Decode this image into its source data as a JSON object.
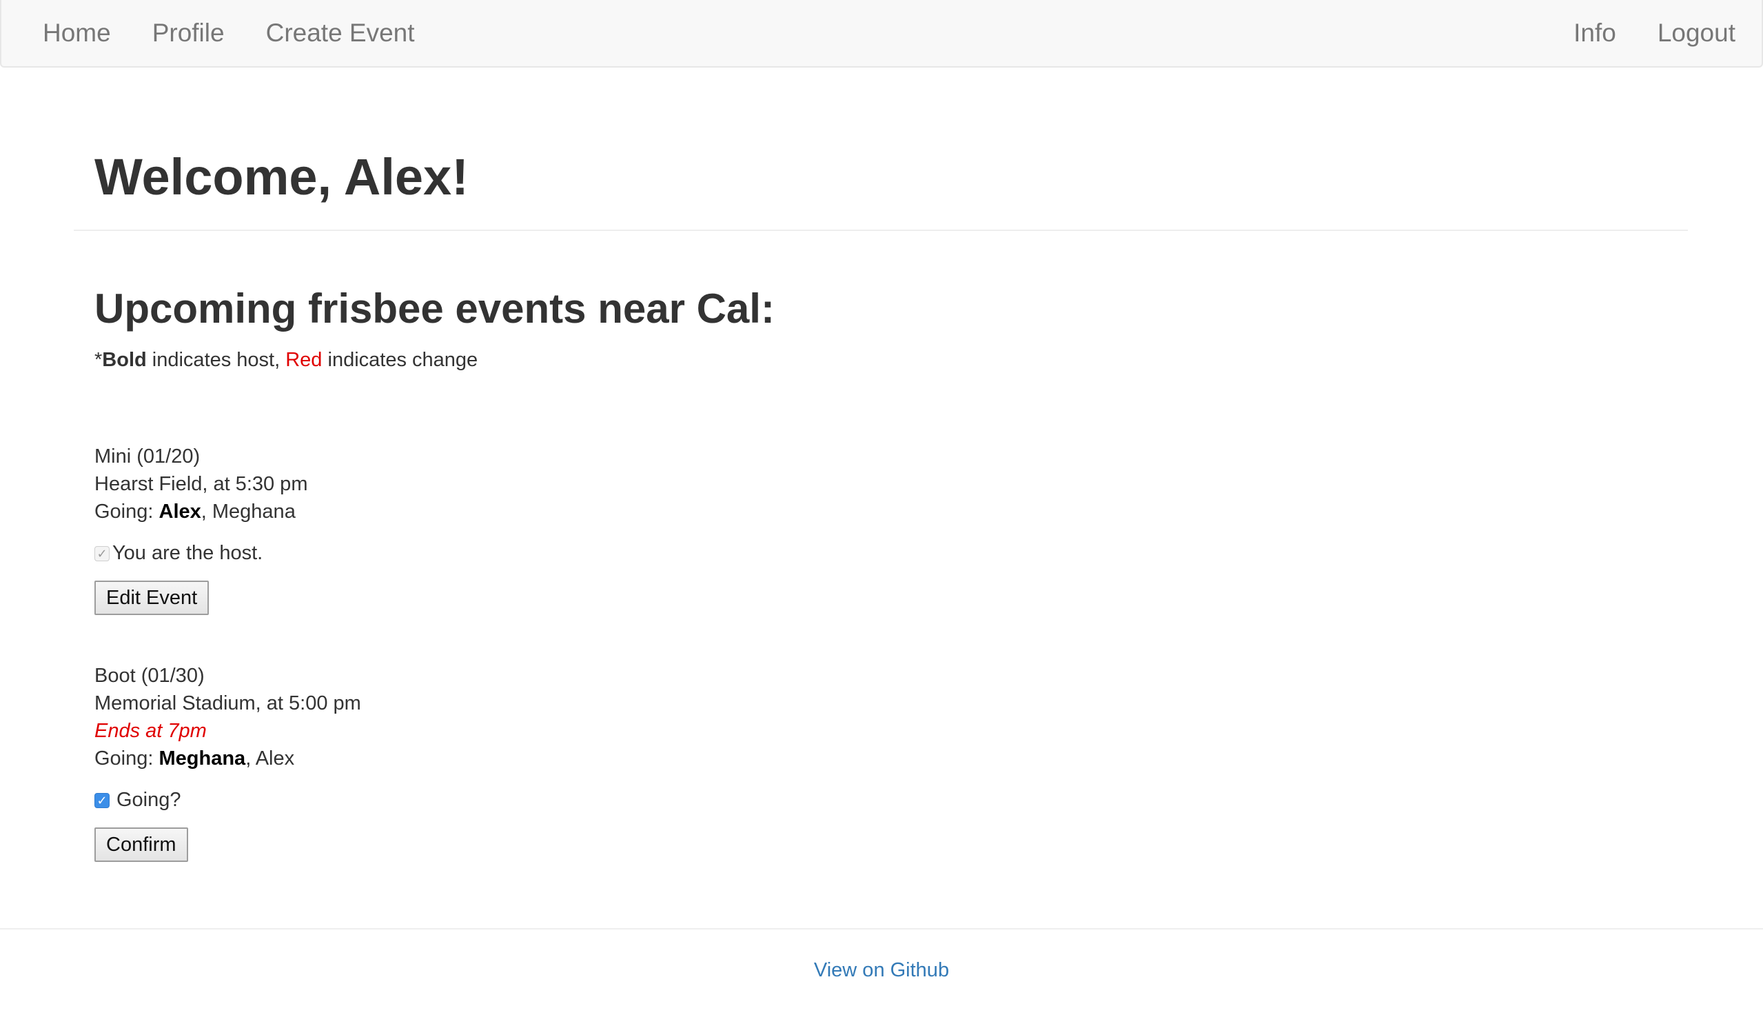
{
  "nav": {
    "left": [
      "Home",
      "Profile",
      "Create Event"
    ],
    "right": [
      "Info",
      "Logout"
    ]
  },
  "welcome": "Welcome, Alex!",
  "section_title": "Upcoming frisbee events near Cal:",
  "legend": {
    "prefix": "*",
    "bold_word": "Bold",
    "middle": " indicates host, ",
    "red_word": "Red",
    "suffix": " indicates change"
  },
  "events": [
    {
      "title": "Mini (01/20)",
      "location": "Hearst Field, at 5:30 pm",
      "change_note": "",
      "going_label": "Going: ",
      "host": "Alex",
      "separator": ", ",
      "others": "Meghana",
      "checkbox_label": "You are the host.",
      "checkbox_checked": true,
      "checkbox_disabled": true,
      "button_label": "Edit Event"
    },
    {
      "title": "Boot (01/30)",
      "location": "Memorial Stadium, at 5:00 pm",
      "change_note": "Ends at 7pm",
      "going_label": "Going: ",
      "host": "Meghana",
      "separator": ", ",
      "others": "Alex",
      "checkbox_label": "Going?",
      "checkbox_checked": true,
      "checkbox_disabled": false,
      "button_label": "Confirm"
    }
  ],
  "footer": {
    "link": "View on Github"
  },
  "colors": {
    "navbar_bg": "#f8f8f8",
    "nav_text": "#777777",
    "change_red": "#e00000",
    "link_blue": "#337ab7",
    "checkbox_blue": "#3b8ee8"
  },
  "icons": {
    "check": "check-icon"
  }
}
